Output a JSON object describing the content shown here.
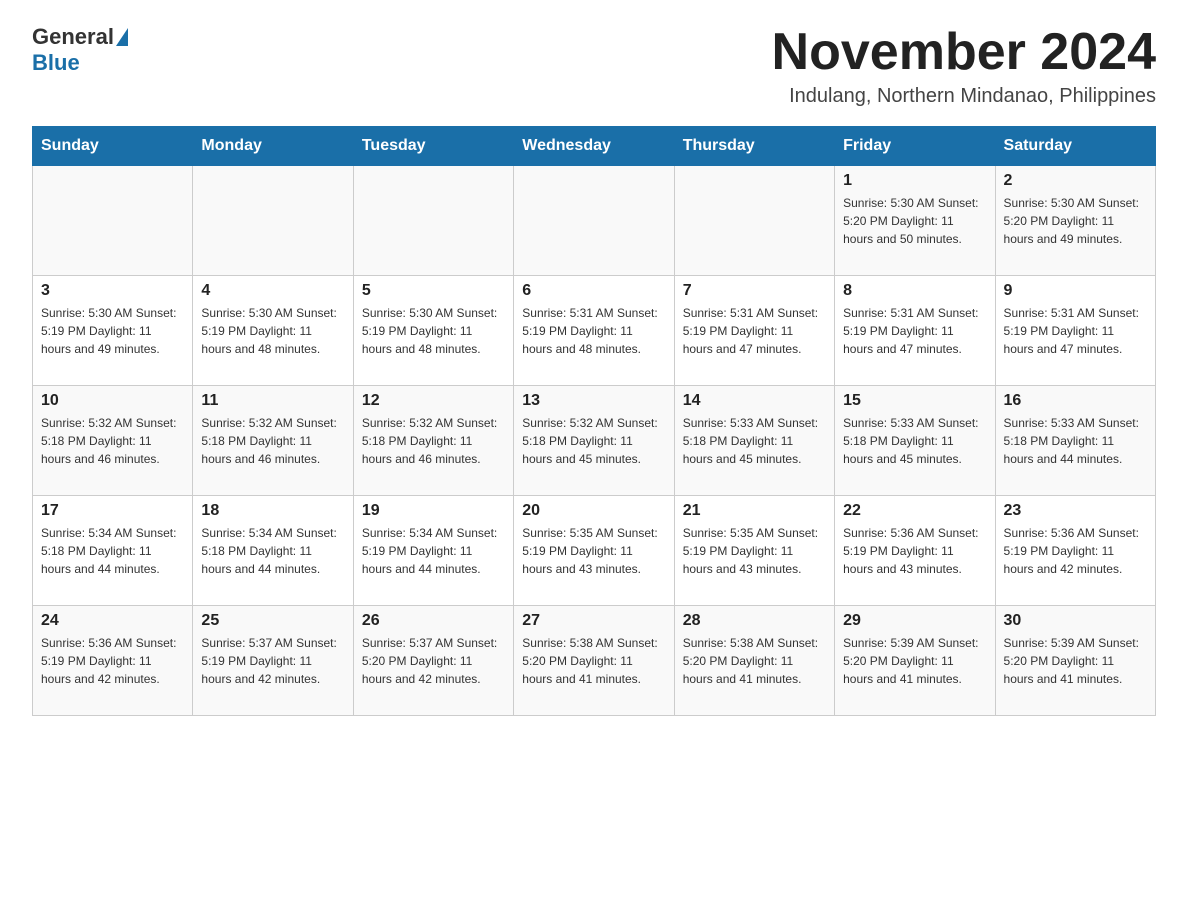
{
  "header": {
    "logo_general": "General",
    "logo_blue": "Blue",
    "month_title": "November 2024",
    "location": "Indulang, Northern Mindanao, Philippines"
  },
  "weekdays": [
    "Sunday",
    "Monday",
    "Tuesday",
    "Wednesday",
    "Thursday",
    "Friday",
    "Saturday"
  ],
  "weeks": [
    [
      {
        "day": "",
        "info": ""
      },
      {
        "day": "",
        "info": ""
      },
      {
        "day": "",
        "info": ""
      },
      {
        "day": "",
        "info": ""
      },
      {
        "day": "",
        "info": ""
      },
      {
        "day": "1",
        "info": "Sunrise: 5:30 AM\nSunset: 5:20 PM\nDaylight: 11 hours\nand 50 minutes."
      },
      {
        "day": "2",
        "info": "Sunrise: 5:30 AM\nSunset: 5:20 PM\nDaylight: 11 hours\nand 49 minutes."
      }
    ],
    [
      {
        "day": "3",
        "info": "Sunrise: 5:30 AM\nSunset: 5:19 PM\nDaylight: 11 hours\nand 49 minutes."
      },
      {
        "day": "4",
        "info": "Sunrise: 5:30 AM\nSunset: 5:19 PM\nDaylight: 11 hours\nand 48 minutes."
      },
      {
        "day": "5",
        "info": "Sunrise: 5:30 AM\nSunset: 5:19 PM\nDaylight: 11 hours\nand 48 minutes."
      },
      {
        "day": "6",
        "info": "Sunrise: 5:31 AM\nSunset: 5:19 PM\nDaylight: 11 hours\nand 48 minutes."
      },
      {
        "day": "7",
        "info": "Sunrise: 5:31 AM\nSunset: 5:19 PM\nDaylight: 11 hours\nand 47 minutes."
      },
      {
        "day": "8",
        "info": "Sunrise: 5:31 AM\nSunset: 5:19 PM\nDaylight: 11 hours\nand 47 minutes."
      },
      {
        "day": "9",
        "info": "Sunrise: 5:31 AM\nSunset: 5:19 PM\nDaylight: 11 hours\nand 47 minutes."
      }
    ],
    [
      {
        "day": "10",
        "info": "Sunrise: 5:32 AM\nSunset: 5:18 PM\nDaylight: 11 hours\nand 46 minutes."
      },
      {
        "day": "11",
        "info": "Sunrise: 5:32 AM\nSunset: 5:18 PM\nDaylight: 11 hours\nand 46 minutes."
      },
      {
        "day": "12",
        "info": "Sunrise: 5:32 AM\nSunset: 5:18 PM\nDaylight: 11 hours\nand 46 minutes."
      },
      {
        "day": "13",
        "info": "Sunrise: 5:32 AM\nSunset: 5:18 PM\nDaylight: 11 hours\nand 45 minutes."
      },
      {
        "day": "14",
        "info": "Sunrise: 5:33 AM\nSunset: 5:18 PM\nDaylight: 11 hours\nand 45 minutes."
      },
      {
        "day": "15",
        "info": "Sunrise: 5:33 AM\nSunset: 5:18 PM\nDaylight: 11 hours\nand 45 minutes."
      },
      {
        "day": "16",
        "info": "Sunrise: 5:33 AM\nSunset: 5:18 PM\nDaylight: 11 hours\nand 44 minutes."
      }
    ],
    [
      {
        "day": "17",
        "info": "Sunrise: 5:34 AM\nSunset: 5:18 PM\nDaylight: 11 hours\nand 44 minutes."
      },
      {
        "day": "18",
        "info": "Sunrise: 5:34 AM\nSunset: 5:18 PM\nDaylight: 11 hours\nand 44 minutes."
      },
      {
        "day": "19",
        "info": "Sunrise: 5:34 AM\nSunset: 5:19 PM\nDaylight: 11 hours\nand 44 minutes."
      },
      {
        "day": "20",
        "info": "Sunrise: 5:35 AM\nSunset: 5:19 PM\nDaylight: 11 hours\nand 43 minutes."
      },
      {
        "day": "21",
        "info": "Sunrise: 5:35 AM\nSunset: 5:19 PM\nDaylight: 11 hours\nand 43 minutes."
      },
      {
        "day": "22",
        "info": "Sunrise: 5:36 AM\nSunset: 5:19 PM\nDaylight: 11 hours\nand 43 minutes."
      },
      {
        "day": "23",
        "info": "Sunrise: 5:36 AM\nSunset: 5:19 PM\nDaylight: 11 hours\nand 42 minutes."
      }
    ],
    [
      {
        "day": "24",
        "info": "Sunrise: 5:36 AM\nSunset: 5:19 PM\nDaylight: 11 hours\nand 42 minutes."
      },
      {
        "day": "25",
        "info": "Sunrise: 5:37 AM\nSunset: 5:19 PM\nDaylight: 11 hours\nand 42 minutes."
      },
      {
        "day": "26",
        "info": "Sunrise: 5:37 AM\nSunset: 5:20 PM\nDaylight: 11 hours\nand 42 minutes."
      },
      {
        "day": "27",
        "info": "Sunrise: 5:38 AM\nSunset: 5:20 PM\nDaylight: 11 hours\nand 41 minutes."
      },
      {
        "day": "28",
        "info": "Sunrise: 5:38 AM\nSunset: 5:20 PM\nDaylight: 11 hours\nand 41 minutes."
      },
      {
        "day": "29",
        "info": "Sunrise: 5:39 AM\nSunset: 5:20 PM\nDaylight: 11 hours\nand 41 minutes."
      },
      {
        "day": "30",
        "info": "Sunrise: 5:39 AM\nSunset: 5:20 PM\nDaylight: 11 hours\nand 41 minutes."
      }
    ]
  ]
}
